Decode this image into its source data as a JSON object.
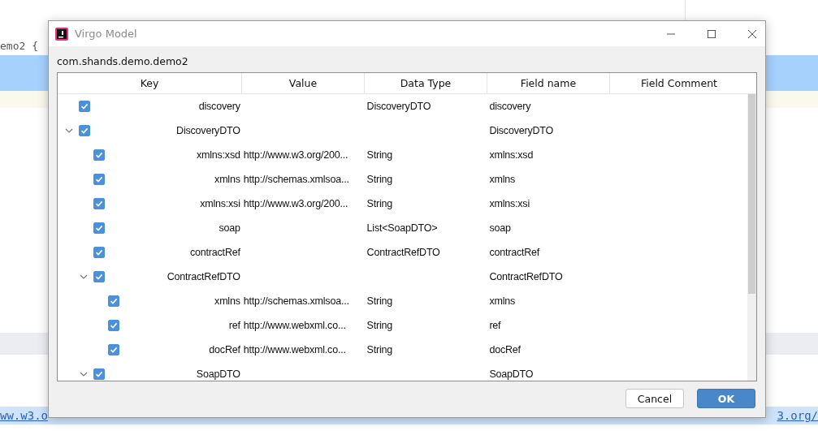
{
  "editor": {
    "code_line": "emo2 {",
    "bottom_left": "ww.w3.o",
    "bottom_right": "3.org/"
  },
  "dialog": {
    "title": "Virgo Model",
    "package": "com.shands.demo.demo2",
    "table": {
      "columns": [
        "Key",
        "Value",
        "Data Type",
        "Field name",
        "Field Comment"
      ],
      "rows": [
        {
          "key": "discovery",
          "checked": true,
          "data_type": "DiscoveryDTO",
          "field_name": "discovery"
        },
        {
          "key": "DiscoveryDTO",
          "checked": true,
          "expanded": true,
          "field_name": "DiscoveryDTO",
          "children": [
            {
              "key": "xmlns:xsd",
              "checked": true,
              "value": "http://www.w3.org/200...",
              "data_type": "String",
              "field_name": "xmlns:xsd"
            },
            {
              "key": "xmlns",
              "checked": true,
              "value": "http://schemas.xmlsoa...",
              "data_type": "String",
              "field_name": "xmlns"
            },
            {
              "key": "xmlns:xsi",
              "checked": true,
              "value": "http://www.w3.org/200...",
              "data_type": "String",
              "field_name": "xmlns:xsi"
            },
            {
              "key": "soap",
              "checked": true,
              "data_type": "List<SoapDTO>",
              "field_name": "soap"
            },
            {
              "key": "contractRef",
              "checked": true,
              "data_type": "ContractRefDTO",
              "field_name": "contractRef"
            },
            {
              "key": "ContractRefDTO",
              "checked": true,
              "expanded": true,
              "field_name": "ContractRefDTO",
              "children": [
                {
                  "key": "xmlns",
                  "checked": true,
                  "value": "http://schemas.xmlsoa...",
                  "data_type": "String",
                  "field_name": "xmlns"
                },
                {
                  "key": "ref",
                  "checked": true,
                  "value": "http://www.webxml.co...",
                  "data_type": "String",
                  "field_name": "ref"
                },
                {
                  "key": "docRef",
                  "checked": true,
                  "value": "http://www.webxml.co...",
                  "data_type": "String",
                  "field_name": "docRef"
                }
              ]
            },
            {
              "key": "SoapDTO",
              "checked": true,
              "expanded": true,
              "field_name": "SoapDTO"
            }
          ]
        }
      ]
    },
    "buttons": [
      {
        "label": "Cancel",
        "kind": "secondary"
      },
      {
        "label": "OK",
        "kind": "primary"
      }
    ]
  }
}
